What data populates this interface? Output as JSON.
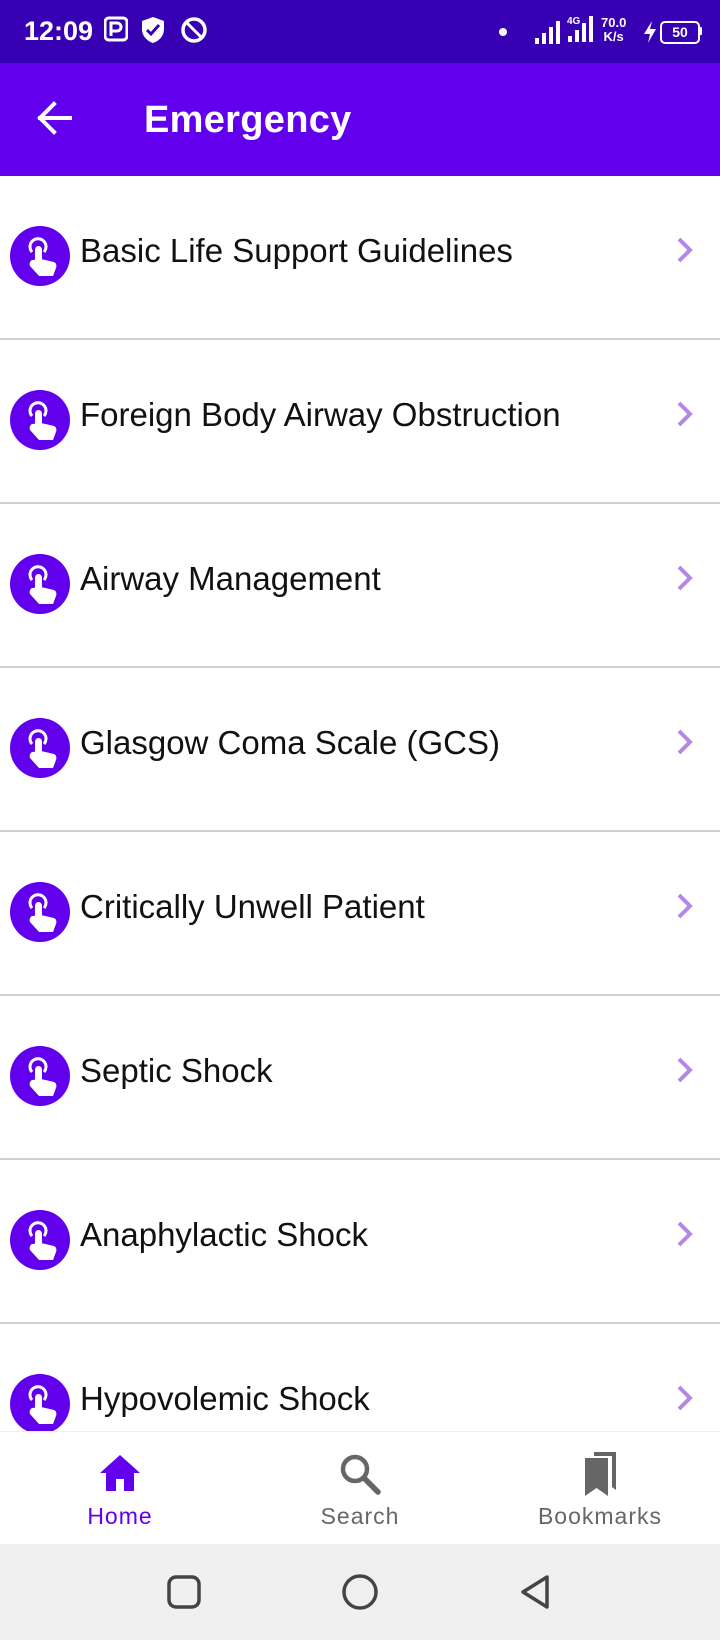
{
  "status_bar": {
    "time": "12:09",
    "speed_value": "70.0",
    "speed_unit": "K/s",
    "network": "4G",
    "battery": "50",
    "icons": [
      "notification-p-icon",
      "shield-icon",
      "data-saver-icon",
      "dot-icon",
      "signal-icon",
      "signal-4g-icon",
      "charging-icon",
      "battery-icon"
    ]
  },
  "app_bar": {
    "title": "Emergency",
    "back_icon": "arrow-left-icon"
  },
  "colors": {
    "status_bar": "#3700b3",
    "primary": "#6200ee",
    "chevron": "#b388e6",
    "divider": "#cfcfcf",
    "nav_inactive": "#666666"
  },
  "list": {
    "item_icon": "touch-tap-icon",
    "trailing_icon": "chevron-right-icon",
    "items": [
      {
        "label": "Basic Life Support Guidelines"
      },
      {
        "label": "Foreign Body Airway Obstruction"
      },
      {
        "label": "Airway Management"
      },
      {
        "label": "Glasgow Coma Scale (GCS)"
      },
      {
        "label": "Critically Unwell Patient"
      },
      {
        "label": "Septic Shock"
      },
      {
        "label": "Anaphylactic Shock"
      },
      {
        "label": "Hypovolemic Shock"
      }
    ]
  },
  "bottom_nav": {
    "items": [
      {
        "label": "Home",
        "icon": "home-icon",
        "active": true
      },
      {
        "label": "Search",
        "icon": "search-icon",
        "active": false
      },
      {
        "label": "Bookmarks",
        "icon": "bookmarks-icon",
        "active": false
      }
    ]
  },
  "system_nav": {
    "buttons": [
      "recents-square-icon",
      "home-circle-icon",
      "back-triangle-icon"
    ]
  }
}
